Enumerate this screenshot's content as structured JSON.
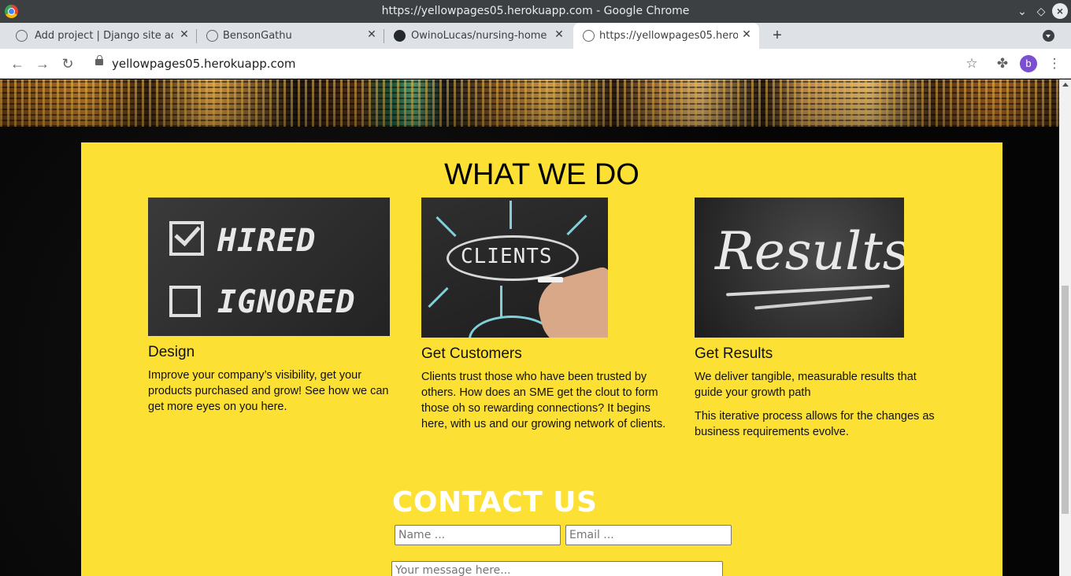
{
  "window": {
    "title": "https://yellowpages05.herokuapp.com - Google Chrome"
  },
  "tabs": [
    {
      "label": "Add project | Django site adm",
      "favicon": "globe-icon",
      "active": false
    },
    {
      "label": "BensonGathu",
      "favicon": "globe-icon",
      "active": false
    },
    {
      "label": "OwinoLucas/nursing-home",
      "favicon": "github-icon",
      "active": false
    },
    {
      "label": "https://yellowpages05.herokuapp.com",
      "favicon": "globe-icon",
      "active": true
    }
  ],
  "address_bar": {
    "url": "yellowpages05.herokuapp.com"
  },
  "profile": {
    "initial": "b",
    "color": "#7b4fcf"
  },
  "page": {
    "section_title": "WHAT WE DO",
    "accent_color": "#fde034",
    "cards": [
      {
        "image_words": [
          "HIRED",
          "IGNORED"
        ],
        "heading": "Design",
        "paragraphs": [
          "Improve your company’s visibility, get your products purchased and grow! See how we can get more eyes on you here."
        ]
      },
      {
        "image_words": [
          "CLIENTS"
        ],
        "heading": "Get Customers",
        "paragraphs": [
          "Clients trust those who have been trusted by others. How does an SME get the clout to form those oh so rewarding connections? It begins here, with us and our growing network of clients."
        ]
      },
      {
        "image_words": [
          "Results"
        ],
        "heading": "Get Results",
        "paragraphs": [
          "We deliver tangible, measurable results that guide your growth path",
          "This iterative process allows for the changes as business requirements evolve."
        ]
      }
    ],
    "contact": {
      "title": "CONTACT US",
      "name_placeholder": "Name ...",
      "email_placeholder": "Email ...",
      "message_placeholder": "Your message here..."
    }
  }
}
